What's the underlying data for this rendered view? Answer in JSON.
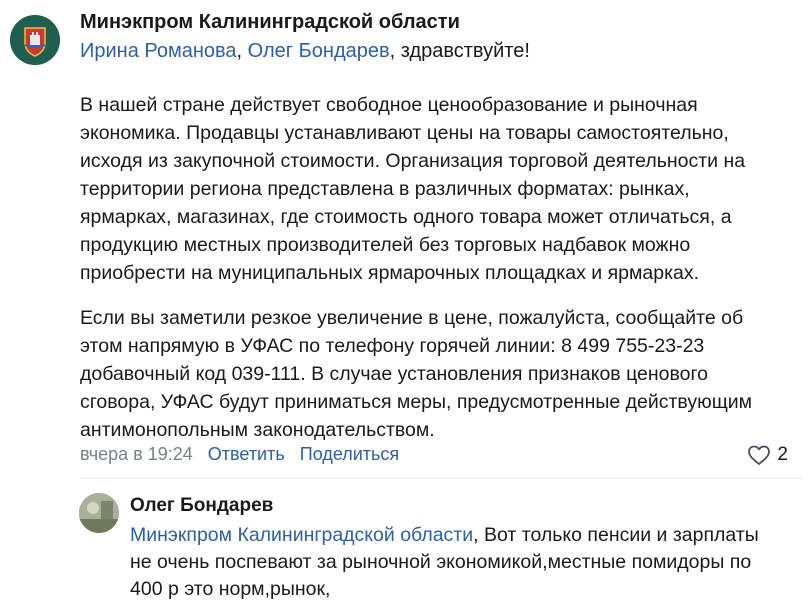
{
  "post": {
    "author": "Минэкпром Калининградской области",
    "greeting": {
      "mention1": "Ирина Романова",
      "separator": ", ",
      "mention2": "Олег Бондарев",
      "rest": ", здравствуйте!"
    },
    "paragraph1": [
      "В нашей стране действует свободное ценообразование и рыночная",
      "экономика. Продавцы устанавливают цены на товары самостоятельно,",
      "исходя из закупочной стоимости. Организация торговой деятельности на",
      "территории региона представлена в различных форматах: рынках,",
      "ярмарках, магазинах, где стоимость одного товара может отличаться, а",
      "продукцию местных производителей без торговых надбавок можно",
      "приобрести на муниципальных ярмарочных площадках и ярмарках."
    ],
    "paragraph2": [
      "Если вы заметили резкое увеличение в цене, пожалуйста, сообщайте об",
      "этом напрямую в УФАС по телефону горячей линии: 8 499 755-23-23",
      "добавочный код 039-111. В случае установления признаков ценового",
      "сговора, УФАС будут приниматься меры, предусмотренные действующим",
      "антимонопольным законодательством."
    ],
    "timestamp": "вчера в 19:24",
    "reply_label": "Ответить",
    "share_label": "Поделиться",
    "likes_count": "2",
    "heart_icon": "heart-outline-icon"
  },
  "reply": {
    "author": "Олег Бондарев",
    "mention": "Минэкпром Калининградской области",
    "lines": [
      ", Вот только пенсии и зарплаты",
      "не очень поспевают за рыночной экономикой,местные помидоры по",
      "400 р это норм,рынок,"
    ]
  },
  "colors": {
    "link": "#2c5fa3",
    "text": "#1a1a1a",
    "muted": "#7a7f86"
  }
}
